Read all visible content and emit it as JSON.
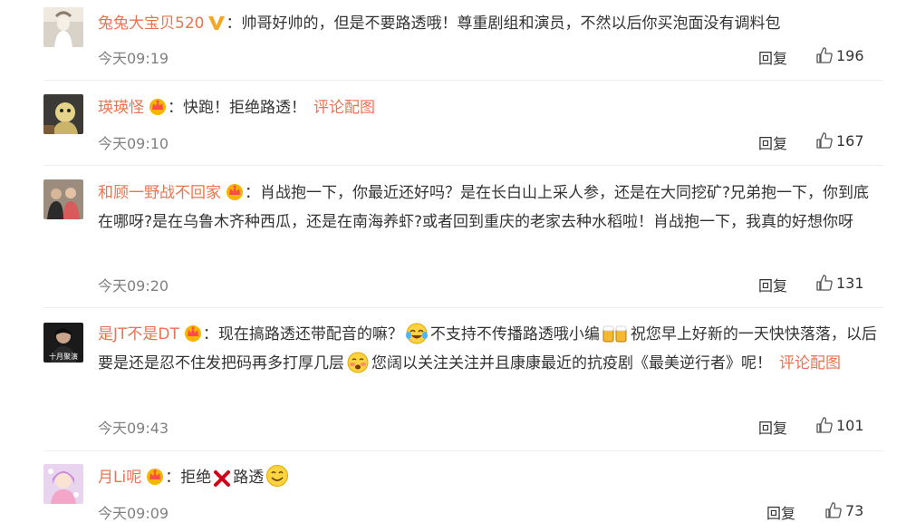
{
  "comments": [
    {
      "user": "兔兔大宝贝520",
      "sep": "：",
      "text": "帅哥好帅的，但是不要路透哦！尊重剧组和演员，不然以后你买泡面没有调料包",
      "time": "今天09:19",
      "reply_label": "回复",
      "likes": "196"
    },
    {
      "user": "瑛瑛怪",
      "sep": "：",
      "text": "快跑！拒绝路透！",
      "link": "评论配图",
      "time": "今天09:10",
      "reply_label": "回复",
      "likes": "167"
    },
    {
      "user": "和顾一野战不回家",
      "sep": "：",
      "text": "肖战抱一下，你最近还好吗？是在长白山上采人参，还是在大同挖矿?兄弟抱一下，你到底在哪呀?是在乌鲁木齐种西瓜，还是在南海养虾?或者回到重庆的老家去种水稻啦！肖战抱一下，我真的好想你呀",
      "time": "今天09:20",
      "reply_label": "回复",
      "likes": "131"
    },
    {
      "user": "是JT不是DT",
      "sep": "：",
      "text1": "现在搞路透还带配音的嘛？",
      "text2": "不支持不传播路透哦小编",
      "text3": "祝您早上好新的一天快快落落，以后要是还是忍不住发把码再多打厚几层",
      "text4": "您阔以关注关注并且康康最近的抗疫剧《最美逆行者》呢！",
      "link": "评论配图",
      "avatar_text": "十月聚演",
      "time": "今天09:43",
      "reply_label": "回复",
      "likes": "101"
    },
    {
      "user": "月Li呢",
      "sep": "：",
      "text1": "拒绝",
      "text2": "路透",
      "time": "今天09:09",
      "reply_label": "回复",
      "likes": "73"
    }
  ],
  "colors": {
    "username": "#eb7350",
    "time": "#808080",
    "text": "#333333",
    "separator": "#eeeeee"
  },
  "icons": {
    "verified": "v-badge-icon",
    "vip": "crown-icon",
    "like": "thumbs-up-icon"
  }
}
